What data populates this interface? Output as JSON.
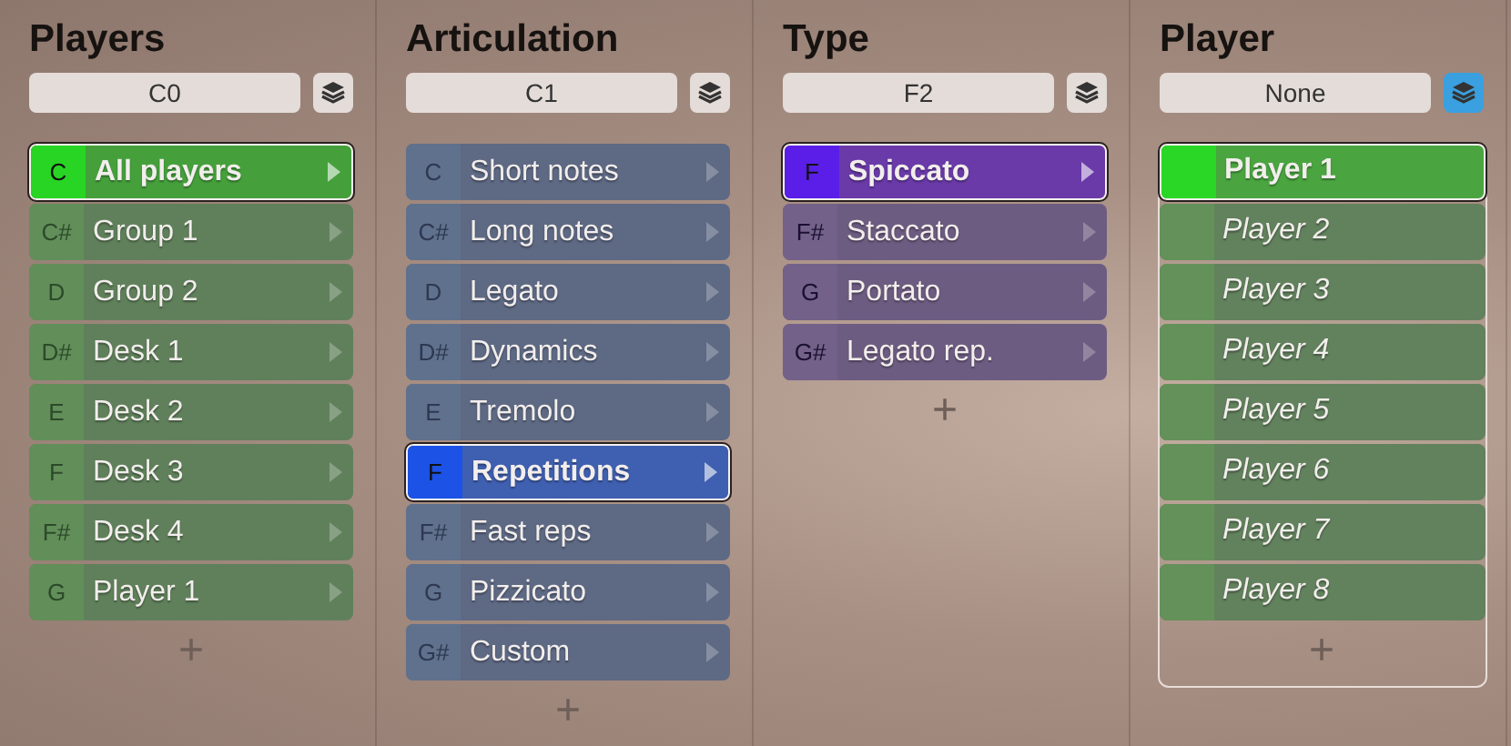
{
  "columns": [
    {
      "title": "Players",
      "kind": "keyed",
      "field": "C0",
      "layers_on": false,
      "focused": false,
      "color": "#45a03c",
      "rows": [
        {
          "note": "C",
          "label": "All players",
          "selected": true,
          "italic": false
        },
        {
          "note": "C#",
          "label": "Group 1",
          "selected": false,
          "italic": false
        },
        {
          "note": "D",
          "label": "Group 2",
          "selected": false,
          "italic": false
        },
        {
          "note": "D#",
          "label": "Desk 1",
          "selected": false,
          "italic": false
        },
        {
          "note": "E",
          "label": "Desk 2",
          "selected": false,
          "italic": false
        },
        {
          "note": "F",
          "label": "Desk 3",
          "selected": false,
          "italic": false
        },
        {
          "note": "F#",
          "label": "Desk 4",
          "selected": false,
          "italic": false
        },
        {
          "note": "G",
          "label": "Player 1",
          "selected": false,
          "italic": false
        }
      ],
      "add": "+"
    },
    {
      "title": "Articulation",
      "kind": "keyed",
      "field": "C1",
      "layers_on": false,
      "focused": false,
      "color": "#3f5fb0",
      "rows": [
        {
          "note": "C",
          "label": "Short notes",
          "selected": false,
          "italic": false
        },
        {
          "note": "C#",
          "label": "Long notes",
          "selected": false,
          "italic": false
        },
        {
          "note": "D",
          "label": "Legato",
          "selected": false,
          "italic": false
        },
        {
          "note": "D#",
          "label": "Dynamics",
          "selected": false,
          "italic": false
        },
        {
          "note": "E",
          "label": "Tremolo",
          "selected": false,
          "italic": false
        },
        {
          "note": "F",
          "label": "Repetitions",
          "selected": true,
          "italic": false
        },
        {
          "note": "F#",
          "label": "Fast reps",
          "selected": false,
          "italic": false
        },
        {
          "note": "G",
          "label": "Pizzicato",
          "selected": false,
          "italic": false
        },
        {
          "note": "G#",
          "label": "Custom",
          "selected": false,
          "italic": false
        }
      ],
      "add": "+"
    },
    {
      "title": "Type",
      "kind": "keyed",
      "field": "F2",
      "layers_on": false,
      "focused": false,
      "color": "#6a3aa8",
      "rows": [
        {
          "note": "F",
          "label": "Spiccato",
          "selected": true,
          "italic": false
        },
        {
          "note": "F#",
          "label": "Staccato",
          "selected": false,
          "italic": false
        },
        {
          "note": "G",
          "label": "Portato",
          "selected": false,
          "italic": false
        },
        {
          "note": "G#",
          "label": "Legato rep.",
          "selected": false,
          "italic": false
        }
      ],
      "add": "+"
    },
    {
      "title": "Player",
      "kind": "plain",
      "field": "None",
      "layers_on": true,
      "focused": true,
      "color": "#4aa540",
      "rows": [
        {
          "label": "Player 1",
          "selected": true,
          "italic": false
        },
        {
          "label": "Player 2",
          "selected": false,
          "italic": true
        },
        {
          "label": "Player 3",
          "selected": false,
          "italic": true
        },
        {
          "label": "Player 4",
          "selected": false,
          "italic": true
        },
        {
          "label": "Player 5",
          "selected": false,
          "italic": true
        },
        {
          "label": "Player 6",
          "selected": false,
          "italic": true
        },
        {
          "label": "Player 7",
          "selected": false,
          "italic": true
        },
        {
          "label": "Player 8",
          "selected": false,
          "italic": true
        }
      ],
      "add": "+"
    }
  ]
}
